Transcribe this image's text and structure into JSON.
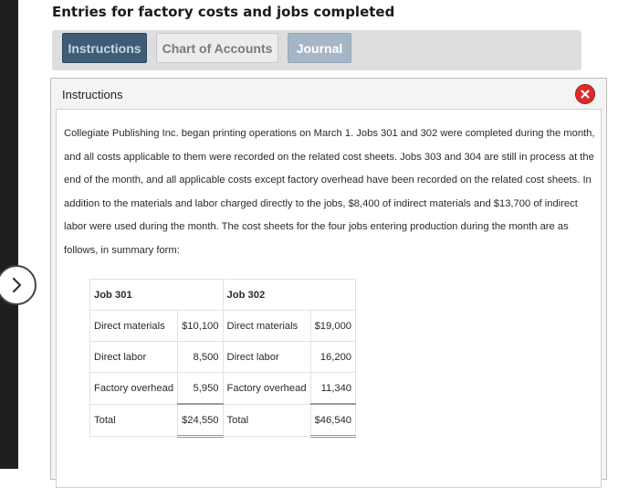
{
  "page": {
    "title": "Entries for factory costs and jobs completed"
  },
  "tabs": [
    {
      "label": "Instructions",
      "active": true
    },
    {
      "label": "Chart of Accounts",
      "active": false
    },
    {
      "label": "Journal",
      "active": false
    }
  ],
  "panel": {
    "label": "Instructions",
    "close_icon": "x-icon",
    "paragraph": "Collegiate Publishing Inc. began printing operations on March 1. Jobs 301 and 302 were completed during the month, and all costs applicable to them were recorded on the related cost sheets. Jobs 303 and 304 are still in process at the end of the month, and all applicable costs except factory overhead have been recorded on the related cost sheets. In addition to the materials and labor charged directly to the jobs, $8,400 of indirect materials and $13,700 of indirect labor were used during the month. The cost sheets for the four jobs entering production during the month are as follows, in summary form:"
  },
  "cost_table": {
    "job_a": "Job 301",
    "job_b": "Job 302",
    "rows": [
      {
        "label_a": "Direct materials",
        "value_a": "$10,100",
        "label_b": "Direct materials",
        "value_b": "$19,000"
      },
      {
        "label_a": "Direct labor",
        "value_a": "8,500",
        "label_b": "Direct labor",
        "value_b": "16,200"
      },
      {
        "label_a": "Factory overhead",
        "value_a": "5,950",
        "label_b": "Factory overhead",
        "value_b": "11,340"
      }
    ],
    "total": {
      "label_a": "Total",
      "value_a": "$24,550",
      "label_b": "Total",
      "value_b": "$46,540"
    }
  },
  "colors": {
    "active_tab": "#3f5c77",
    "close_button": "#d92d2d",
    "sidebar": "#1f1f1f"
  },
  "nav": {
    "icon": "chevron-right-icon"
  }
}
